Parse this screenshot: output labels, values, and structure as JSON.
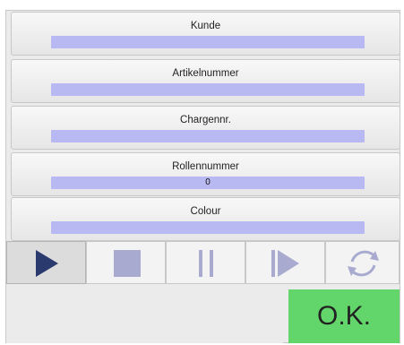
{
  "fields": [
    {
      "label": "Kunde",
      "value": ""
    },
    {
      "label": "Artikelnummer",
      "value": ""
    },
    {
      "label": "Chargennr.",
      "value": ""
    },
    {
      "label": "Rollennummer",
      "value": "0"
    },
    {
      "label": "Colour",
      "value": ""
    }
  ],
  "controls": {
    "icons": [
      "play-icon",
      "stop-icon",
      "pause-icon",
      "step-forward-icon",
      "refresh-icon"
    ],
    "active_color": "#2b3a6e",
    "inactive_color": "#a8abcf"
  },
  "ok_button": {
    "label": "O.K.",
    "color": "#63d66b"
  }
}
